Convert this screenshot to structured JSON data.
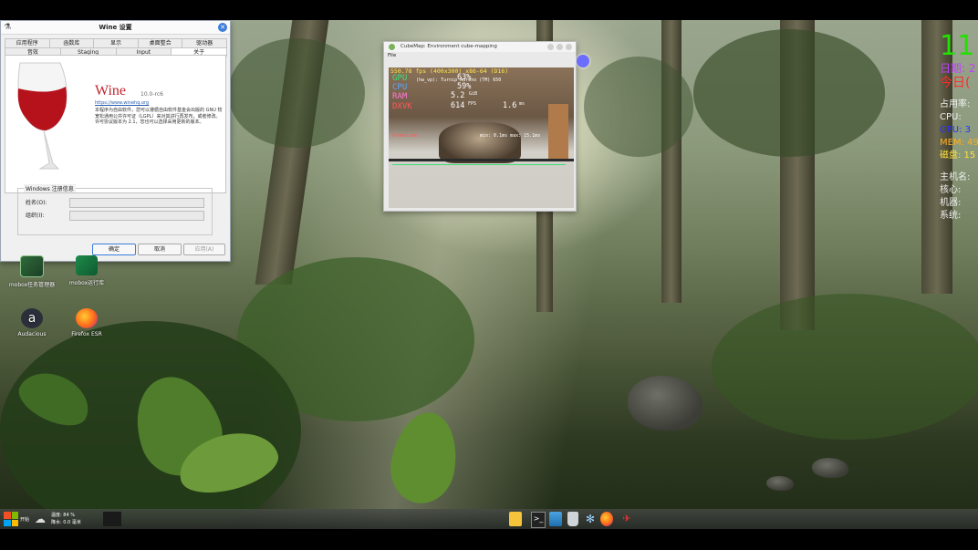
{
  "wine_window": {
    "title": "Wine 设置",
    "tabs_row1": [
      "应用程序",
      "函数库",
      "显示",
      "桌面整合",
      "驱动器"
    ],
    "tabs_row2": [
      "音效",
      "Staging",
      "Input",
      "关于"
    ],
    "active_tab": "关于",
    "product_name": "Wine",
    "version": "10.0-rc6",
    "url": "https://www.winehq.org",
    "description": "本程序为自由软件，您可以遵循自由软件基金会出版的 GNU 较宽松通用公共许可证（LGPL）来对其进行再发布，或者修改。许可协议版本为 2.1，您也可以选择采用更新的版本。",
    "registration_group": "Windows 注册信息",
    "owner_label": "姓名(O):",
    "owner_value": "",
    "org_label": "组织(I):",
    "org_value": "",
    "ok_button": "确定",
    "cancel_button": "取消",
    "apply_button": "应用(A)"
  },
  "cube_window": {
    "title": "CubeMap: Environment cube-mapping",
    "menu_file": "File",
    "hud_fps": "550.78 fps (400x300) x86-64 (D16)",
    "hud_device": "(hw_vp): Turnip Adreno (TM) 650",
    "hud_gpu_label": "GPU",
    "hud_gpu_value": "63%",
    "hud_cpu_label": "CPU",
    "hud_cpu_value": "59%",
    "hud_ram_label": "RAM",
    "hud_ram_value": "5.2",
    "hud_ram_unit": "GiB",
    "hud_dxvk_label": "DXVK",
    "hud_dxvk_fps": "614",
    "hud_dxvk_fps_unit": "FPS",
    "hud_dxvk_ms": "1.6",
    "hud_dxvk_ms_unit": "ms",
    "hud_frametime_label": "Frametime",
    "hud_frametime_stats": "min: 0.1ms  max: 15.1ms"
  },
  "desktop_icons": [
    {
      "label": "mobox任务管理器",
      "icon": "mobox-task-manager-icon"
    },
    {
      "label": "mobox运行库",
      "icon": "mobox-runtime-icon"
    },
    {
      "label": "Audacious",
      "icon": "audacious-icon"
    },
    {
      "label": "Firefox ESR",
      "icon": "firefox-icon"
    }
  ],
  "sysinfo": {
    "time": "11",
    "date_label": "日期: 2",
    "today_label": "今日(",
    "user_label": "占用率:",
    "cpu_label": "CPU:",
    "gpu_label": "GPU: 3",
    "mem_label": "MEM: 49",
    "disk_label": "磁盘: 15",
    "host_label": "主机名:",
    "core_label": "核心:",
    "model_label": "机器:",
    "system_label": "系统:"
  },
  "taskbar": {
    "start_label": "开始",
    "weather_line1": "温度: 84 %",
    "weather_line2": "降水: 0.0 毫米"
  },
  "colors": {
    "time": "#22e000",
    "date": "#c040ff",
    "today": "#ff2a2a",
    "sys_white": "#f0f0f0",
    "gpu_info": "#2030ff",
    "mem": "#ffb020",
    "disk": "#ffe040"
  }
}
